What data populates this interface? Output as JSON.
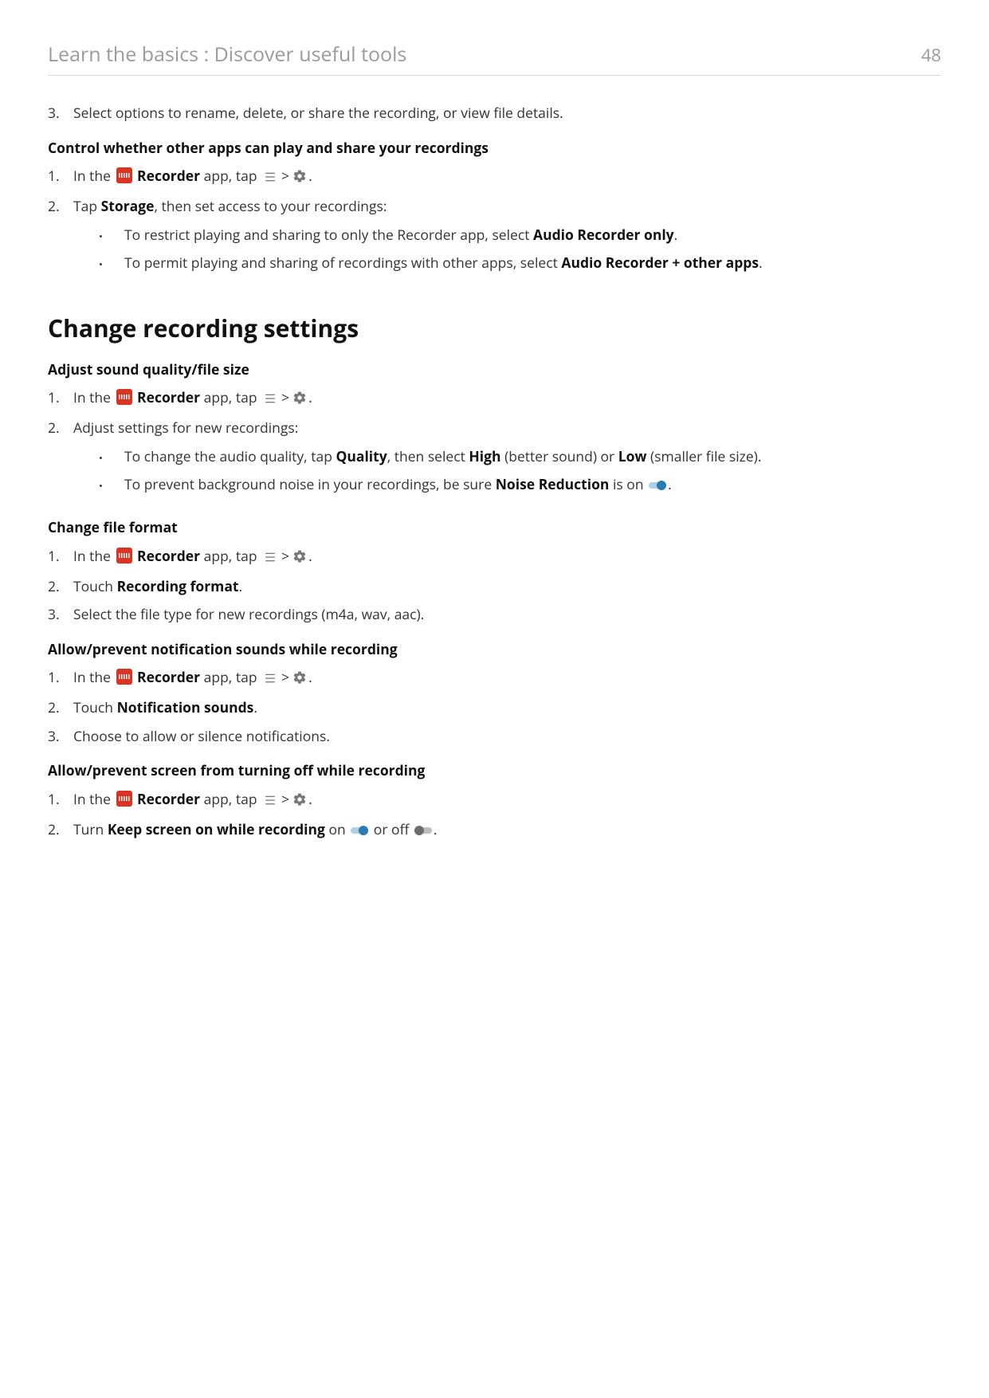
{
  "header": {
    "title": "Learn the basics : Discover useful tools",
    "page": "48"
  },
  "intro": {
    "step3_num": "3.",
    "step3_text": "Select options to rename, delete, or share the recording, or view file details.",
    "control_head": "Control whether other apps can play and share your recordings",
    "l1_num": "1.",
    "l1_pre": "In the ",
    "l1_bold": " Recorder",
    "l1_post1": " app, tap ",
    "l1_gt": ">",
    "l1_end": ".",
    "l2_num": "2.",
    "l2_pre": "Tap ",
    "l2_bold": "Storage",
    "l2_post": ", then set access to your recordings:",
    "b1_pre": "To restrict playing and sharing to only the Recorder app, select ",
    "b1_bold": "Audio Recorder only",
    "b1_end": ".",
    "b2_pre": "To permit playing and sharing of recordings with other apps, select ",
    "b2_bold": "Audio Recorder + other apps",
    "b2_end": "."
  },
  "change": {
    "heading": "Change recording settings",
    "sub1": "Adjust sound quality/file size",
    "s1_l1_num": "1.",
    "s1_l1_pre": "In the ",
    "s1_l1_bold": " Recorder",
    "s1_l1_post": " app, tap ",
    "s1_l1_gt": ">",
    "s1_l1_end": ".",
    "s1_l2_num": "2.",
    "s1_l2_text": "Adjust settings for new recordings:",
    "s1_b1_pre": "To change the audio quality, tap ",
    "s1_b1_b1": "Quality",
    "s1_b1_mid1": ", then select ",
    "s1_b1_b2": "High",
    "s1_b1_mid2": " (better sound) or ",
    "s1_b1_b3": "Low",
    "s1_b1_end": " (smaller file size).",
    "s1_b2_pre": "To prevent background noise in your recordings, be sure ",
    "s1_b2_b1": "Noise Reduction",
    "s1_b2_mid": " is on ",
    "s1_b2_end": ".",
    "sub2": "Change file format",
    "s2_l1_num": "1.",
    "s2_l1_pre": "In the ",
    "s2_l1_bold": " Recorder",
    "s2_l1_post": " app, tap ",
    "s2_l1_gt": ">",
    "s2_l1_end": ".",
    "s2_l2_num": "2.",
    "s2_l2_pre": "Touch ",
    "s2_l2_b": "Recording format",
    "s2_l2_end": ".",
    "s2_l3_num": "3.",
    "s2_l3_text": "Select the file type for new recordings (m4a, wav, aac).",
    "sub3": "Allow/prevent notification sounds while recording",
    "s3_l1_num": "1.",
    "s3_l1_pre": "In the ",
    "s3_l1_bold": " Recorder",
    "s3_l1_post": " app, tap ",
    "s3_l1_gt": ">",
    "s3_l1_end": ".",
    "s3_l2_num": "2.",
    "s3_l2_pre": "Touch ",
    "s3_l2_b": "Notification sounds",
    "s3_l2_end": ".",
    "s3_l3_num": "3.",
    "s3_l3_text": "Choose to allow or silence notifications.",
    "sub4": "Allow/prevent screen from turning off while recording",
    "s4_l1_num": "1.",
    "s4_l1_pre": "In the ",
    "s4_l1_bold": " Recorder",
    "s4_l1_post": " app, tap ",
    "s4_l1_gt": ">",
    "s4_l1_end": ".",
    "s4_l2_num": "2.",
    "s4_l2_pre": "Turn ",
    "s4_l2_b": "Keep screen on while recording",
    "s4_l2_mid1": " on ",
    "s4_l2_mid2": " or off ",
    "s4_l2_end": "."
  }
}
